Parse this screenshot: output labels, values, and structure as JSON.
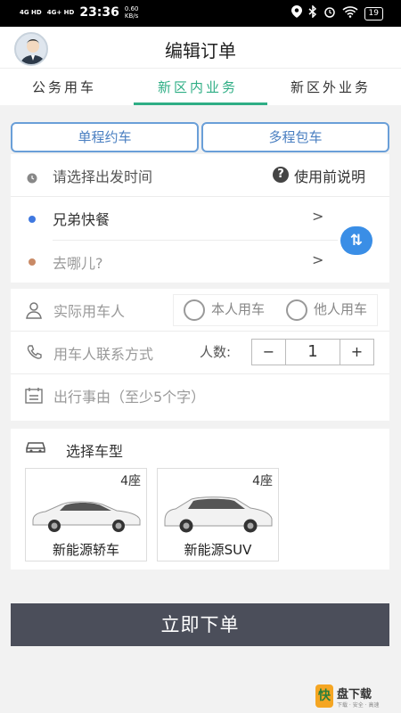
{
  "status_bar": {
    "signal_1": "4G HD",
    "signal_2": "4G+ HD",
    "time": "23:36",
    "speed_value": "0.60",
    "speed_unit": "KB/s",
    "battery": "19"
  },
  "header": {
    "title": "编辑订单"
  },
  "tabs": [
    {
      "label": "公务用车",
      "active": false
    },
    {
      "label": "新区内业务",
      "active": true
    },
    {
      "label": "新区外业务",
      "active": false
    }
  ],
  "mode_buttons": {
    "single": "单程约车",
    "multi": "多程包车"
  },
  "trip": {
    "time_placeholder": "请选择出发时间",
    "help_label": "使用前说明",
    "origin": "兄弟快餐",
    "destination_placeholder": "去哪儿?",
    "chevron": ">",
    "swap_glyph": "⇅"
  },
  "rider": {
    "user_placeholder": "实际用车人",
    "option_self": "本人用车",
    "option_other": "他人用车",
    "contact_placeholder": "用车人联系方式",
    "count_label": "人数:",
    "minus": "−",
    "count_value": "1",
    "plus": "+",
    "reason_placeholder": "出行事由（至少5个字）"
  },
  "vehicle": {
    "section_title": "选择车型",
    "options": [
      {
        "seats": "4座",
        "name": "新能源轿车"
      },
      {
        "seats": "4座",
        "name": "新能源SUV"
      }
    ]
  },
  "submit_label": "立即下单",
  "watermark": {
    "logo_glyph": "快",
    "text": "盘下载",
    "sub": "下载 · 安全 · 高速"
  },
  "colors": {
    "accent_green": "#2fae85",
    "accent_blue": "#3a8ee6",
    "submit_bg": "#4b4e5a"
  }
}
